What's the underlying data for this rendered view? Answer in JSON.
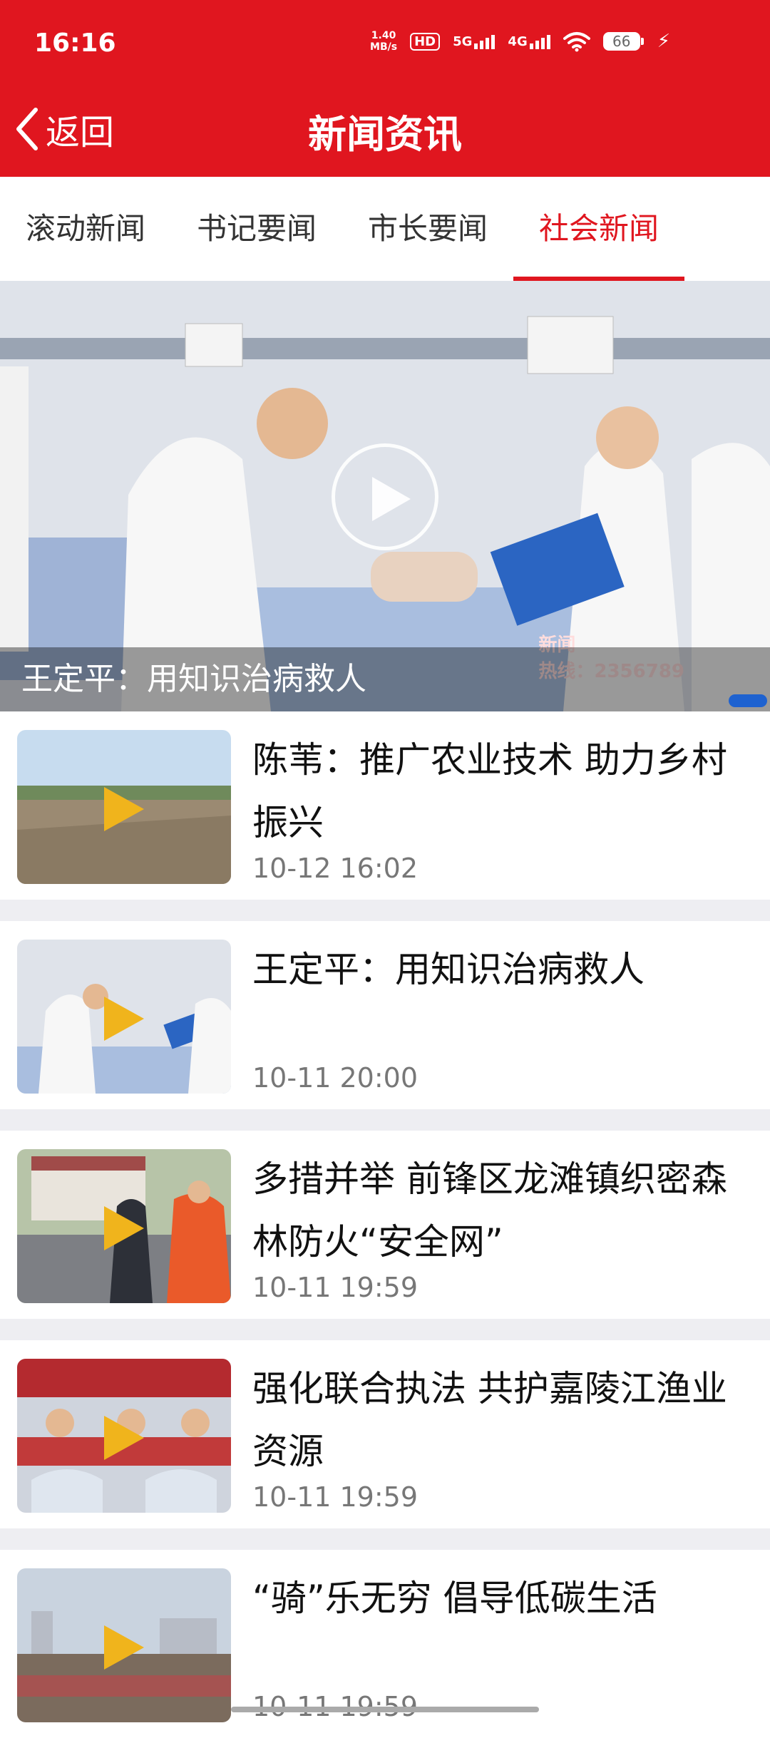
{
  "status_bar": {
    "time": "16:16",
    "net_speed_value": "1.40",
    "net_speed_unit": "MB/s",
    "hd_label": "HD",
    "sim1_label": "5G",
    "sim2_label": "4G",
    "battery_level": "66"
  },
  "header": {
    "back_label": "返回",
    "title": "新闻资讯",
    "background_color": "#E0161F"
  },
  "tabs": [
    {
      "label": "滚动新闻",
      "active": false
    },
    {
      "label": "书记要闻",
      "active": false
    },
    {
      "label": "市长要闻",
      "active": false
    },
    {
      "label": "社会新闻",
      "active": true
    }
  ],
  "hero": {
    "caption": "王定平：用知识治病救人",
    "stamp_line1": "新闻",
    "stamp_line2": "热线：2356789"
  },
  "news": [
    {
      "title": "陈苇：推广农业技术 助力乡村振兴",
      "time": "10-12 16:02",
      "thumb": "farmland"
    },
    {
      "title": "王定平：用知识治病救人",
      "time": "10-11 20:00",
      "thumb": "hospital"
    },
    {
      "title": "多措并举 前锋区龙滩镇织密森林防火“安全网”",
      "time": "10-11 19:59",
      "thumb": "fire-safety"
    },
    {
      "title": "强化联合执法 共护嘉陵江渔业资源",
      "time": "10-11 19:59",
      "thumb": "meeting"
    },
    {
      "title": "“骑”乐无穷 倡导低碳生活",
      "time": "10-11 19:59",
      "thumb": "cycling"
    }
  ],
  "colors": {
    "accent": "#E0161F",
    "play_icon": "#F0B41C",
    "separator": "#EEEEF2"
  }
}
